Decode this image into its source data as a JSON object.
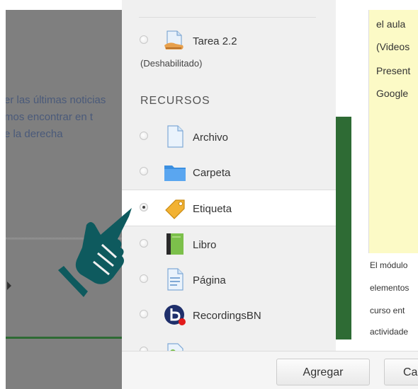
{
  "background": {
    "left_text_lines": [
      "er las últimas noticias",
      "mos encontrar en t",
      "e la derecha"
    ]
  },
  "chooser": {
    "activities_tail": {
      "item_label": "Tarea 2.2",
      "item_sublabel": "(Deshabilitado)",
      "icon": "assignment-icon"
    },
    "resources_heading": "RECURSOS",
    "resources": [
      {
        "label": "Archivo",
        "icon": "file-icon",
        "selected": false
      },
      {
        "label": "Carpeta",
        "icon": "folder-icon",
        "selected": false
      },
      {
        "label": "Etiqueta",
        "icon": "tag-icon",
        "selected": true
      },
      {
        "label": "Libro",
        "icon": "book-icon",
        "selected": false
      },
      {
        "label": "Página",
        "icon": "page-icon",
        "selected": false
      },
      {
        "label": "RecordingsBN",
        "icon": "bigbluebutton-icon",
        "selected": false
      }
    ]
  },
  "help_panel": {
    "box_lines": [
      "el aula",
      "(Videos",
      "Present",
      "Google"
    ],
    "text_lines": [
      "El módulo",
      "elementos",
      "curso ent",
      "actividade"
    ]
  },
  "footer": {
    "add_button": "Agregar",
    "cancel_button": "Ca"
  },
  "colors": {
    "accent_green": "#2e6b34",
    "hand_color": "#0e5a5e",
    "help_box_bg": "#fcfac6"
  }
}
